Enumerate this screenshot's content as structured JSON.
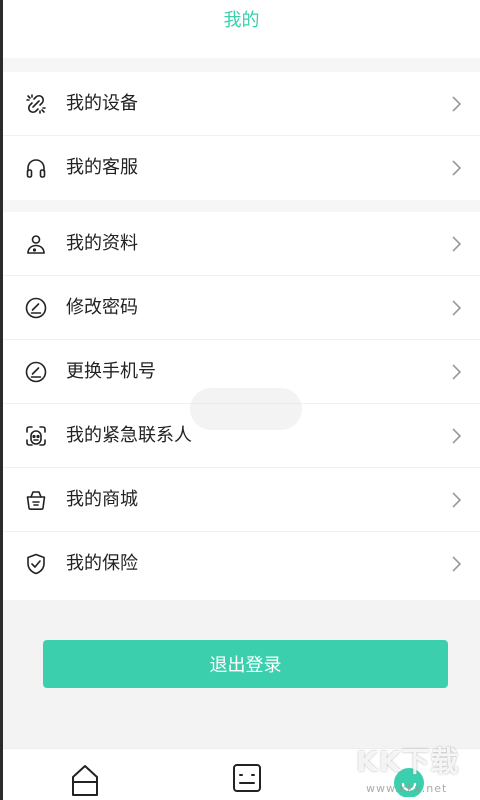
{
  "header": {
    "title": "我的"
  },
  "accent_color": "#3ccfae",
  "section1": {
    "items": [
      {
        "label": "我的设备",
        "icon": "broken-link-icon"
      },
      {
        "label": "我的客服",
        "icon": "headphones-icon"
      }
    ]
  },
  "section2": {
    "items": [
      {
        "label": "我的资料",
        "icon": "person-icon"
      },
      {
        "label": "修改密码",
        "icon": "edit-circle-icon"
      },
      {
        "label": "更换手机号",
        "icon": "edit-circle-icon"
      },
      {
        "label": "我的紧急联系人",
        "icon": "face-frame-icon"
      },
      {
        "label": "我的商城",
        "icon": "basket-icon"
      },
      {
        "label": "我的保险",
        "icon": "shield-check-icon"
      }
    ]
  },
  "logout": {
    "label": "退出登录"
  },
  "tabbar": {
    "tabs": [
      {
        "icon": "home-icon"
      },
      {
        "icon": "list-icon"
      },
      {
        "icon": "me-icon"
      }
    ]
  },
  "watermark": {
    "main": "KK下载",
    "sub": "www.kkx.net"
  }
}
